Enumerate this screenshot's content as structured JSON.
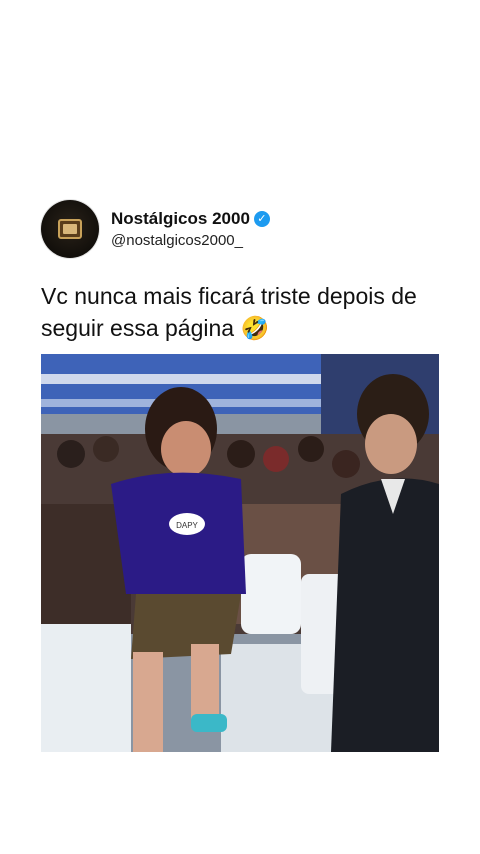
{
  "post": {
    "author": {
      "display_name": "Nostálgicos 2000",
      "handle": "@nostalgicos2000_",
      "verified": true,
      "avatar_icon": "retro-tv-logo"
    },
    "caption": "Vc nunca mais ficará triste depois de seguir essa página 🤣",
    "media": {
      "type": "video-frame",
      "name_tags": [
        "DAPY"
      ]
    }
  },
  "colors": {
    "background": "#ffffff",
    "verified_badge": "#1d9bf0",
    "text": "#111111"
  }
}
